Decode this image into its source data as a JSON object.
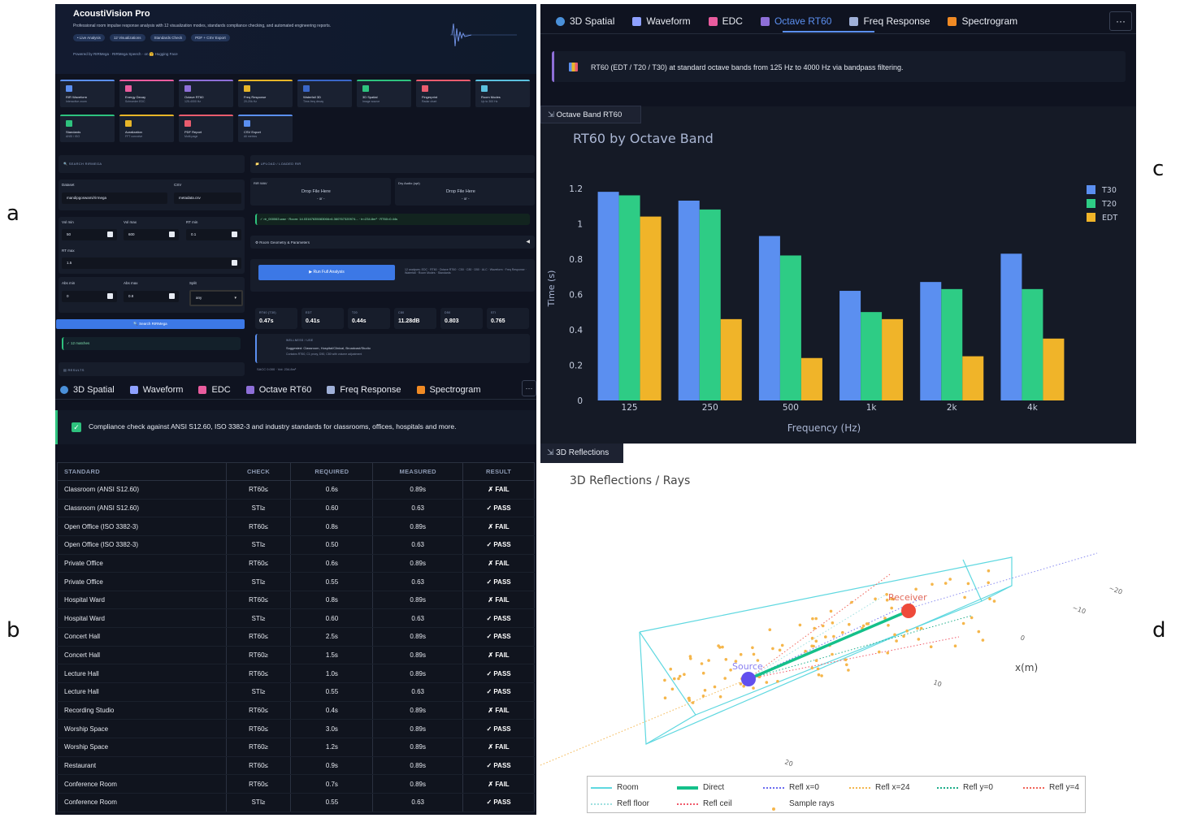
{
  "panel_labels": {
    "a": "a",
    "b": "b",
    "c": "c",
    "d": "d"
  },
  "app": {
    "title": "AcoustiVision Pro",
    "subtitle": "Professional room impulse response analysis with 12 visualization modes, standards compliance checking, and automated engineering reports.",
    "pills": [
      "• Live Analysis",
      "12 Visualizations",
      "Standards Check",
      "PDF + CSV Export"
    ],
    "credit": "Powered by  RIRMega  ·  RIRMega Speech  ·  on 🤗 Hugging Face"
  },
  "cards": [
    {
      "title": "RIR Waveform",
      "sub": "Interactive zoom",
      "color": "#5b8ff0"
    },
    {
      "title": "Energy Decay",
      "sub": "Schroeder EDC",
      "color": "#e95c9e"
    },
    {
      "title": "Octave RT60",
      "sub": "125-4000 Hz",
      "color": "#8e6fd8"
    },
    {
      "title": "Freq Response",
      "sub": "20-20k Hz",
      "color": "#e7b528"
    },
    {
      "title": "Waterfall 3D",
      "sub": "Time-freq decay",
      "color": "#3a66c8"
    },
    {
      "title": "3D Spatial",
      "sub": "Image source",
      "color": "#2ec27e"
    },
    {
      "title": "Fingerprint",
      "sub": "Radar chart",
      "color": "#e95c6e"
    },
    {
      "title": "Room Modes",
      "sub": "Up to 300 Hz",
      "color": "#5bc0de"
    },
    {
      "title": "Standards",
      "sub": "ANSI / ISO",
      "color": "#2ec27e"
    },
    {
      "title": "Auralization",
      "sub": "FFT convolve",
      "color": "#e7b528"
    },
    {
      "title": "PDF Report",
      "sub": "Multi-page",
      "color": "#e95c6e"
    },
    {
      "title": "CSV Export",
      "sub": "All metrics",
      "color": "#5b8ff0"
    }
  ],
  "search": {
    "header": "🔍 SEARCH RIRMEGA",
    "dataset_label": "Dataset",
    "dataset_value": "mandipgoswami/rirmega",
    "csv_label": "CSV",
    "csv_value": "metadata.csv",
    "vol_min_label": "Vol min",
    "vol_min": "50",
    "vol_max_label": "Vol max",
    "vol_max": "600",
    "rt_min_label": "RT min",
    "rt_min": "0.1",
    "rt_max_label": "RT max",
    "rt_max": "1.5",
    "abs_min_label": "Abs min",
    "abs_min": "0",
    "abs_max_label": "Abs max",
    "abs_max": "0.8",
    "split_label": "Split",
    "split_value": "any",
    "button": "🔍 Search RIRMega",
    "matches": "✓ 12 matches",
    "results_header": "▤ RESULTS"
  },
  "upload": {
    "header": "📁 UPLOAD / LOADED RIR",
    "rir_label": "RIR WAV",
    "dry_label": "Dry Audio (opt)",
    "drop_text": "Drop File Here",
    "or_text": "- or -",
    "loaded": "✓ rir_000063.wav · Room: 14.03167635083066×6.360767320974... · tr=234.8m³ · RT60=0.44s",
    "geometry": "⚙ Room Geometry & Parameters",
    "run_button": "▶ Run Full Analysis",
    "run_note": "12 analyses: EDC · RT60 · Octave RT60 · C50 · C80 · D50 · ALC · Waveform · Freq Response · Waterfall · Room Modes · Standards",
    "metrics": [
      {
        "label": "RT60 (T30)",
        "value": "0.47s"
      },
      {
        "label": "EDT",
        "value": "0.41s"
      },
      {
        "label": "T20",
        "value": "0.44s"
      },
      {
        "label": "C80",
        "value": "11.28dB"
      },
      {
        "label": "D50",
        "value": "0.803"
      },
      {
        "label": "STI",
        "value": "0.765"
      }
    ],
    "wellness_header": "WELLNESS / USE",
    "wellness_text": "Suggested: Classroom, Hospital/Clinical, Broadcast/Studio",
    "wellness_sub": "Contains RT60, C1 proxy, D50, C80 with volume adjustment",
    "footer": "SACC 0.000 · Vol: 234.8m³"
  },
  "tabs_bottom": [
    {
      "label": "3D Spatial",
      "icon": "globe-icon",
      "color": "#4a90d9"
    },
    {
      "label": "Waveform",
      "icon": "wave-icon",
      "color": "#8ea0ff"
    },
    {
      "label": "EDC",
      "icon": "chart-down-icon",
      "color": "#e95c9e"
    },
    {
      "label": "Octave RT60",
      "icon": "bar-chart-icon",
      "color": "#8e6fd8"
    },
    {
      "label": "Freq Response",
      "icon": "line-chart-icon",
      "color": "#9fb0d8"
    },
    {
      "label": "Spectrogram",
      "icon": "flame-icon",
      "color": "#f08a24"
    }
  ],
  "tabs_top": [
    {
      "label": "3D Spatial",
      "icon": "globe-icon",
      "color": "#4a90d9"
    },
    {
      "label": "Waveform",
      "icon": "wave-icon",
      "color": "#8ea0ff"
    },
    {
      "label": "EDC",
      "icon": "chart-down-icon",
      "color": "#e95c9e"
    },
    {
      "label": "Octave RT60",
      "icon": "bar-chart-icon",
      "color": "#8e6fd8"
    },
    {
      "label": "Freq Response",
      "icon": "line-chart-icon",
      "color": "#9fb0d8"
    },
    {
      "label": "Spectrogram",
      "icon": "flame-icon",
      "color": "#f08a24"
    }
  ],
  "more_label": "···",
  "compliance": {
    "note": "Compliance check against ANSI S12.60, ISO 3382-3 and industry standards for classrooms, offices, hospitals and more.",
    "columns": [
      "STANDARD",
      "CHECK",
      "REQUIRED",
      "MEASURED",
      "RESULT"
    ],
    "rows": [
      [
        "Classroom (ANSI S12.60)",
        "RT60≤",
        "0.6s",
        "0.89s",
        "✗ FAIL"
      ],
      [
        "Classroom (ANSI S12.60)",
        "STI≥",
        "0.60",
        "0.63",
        "✓ PASS"
      ],
      [
        "Open Office (ISO 3382-3)",
        "RT60≤",
        "0.8s",
        "0.89s",
        "✗ FAIL"
      ],
      [
        "Open Office (ISO 3382-3)",
        "STI≥",
        "0.50",
        "0.63",
        "✓ PASS"
      ],
      [
        "Private Office",
        "RT60≤",
        "0.6s",
        "0.89s",
        "✗ FAIL"
      ],
      [
        "Private Office",
        "STI≥",
        "0.55",
        "0.63",
        "✓ PASS"
      ],
      [
        "Hospital Ward",
        "RT60≤",
        "0.8s",
        "0.89s",
        "✗ FAIL"
      ],
      [
        "Hospital Ward",
        "STI≥",
        "0.60",
        "0.63",
        "✓ PASS"
      ],
      [
        "Concert Hall",
        "RT60≤",
        "2.5s",
        "0.89s",
        "✓ PASS"
      ],
      [
        "Concert Hall",
        "RT60≥",
        "1.5s",
        "0.89s",
        "✗ FAIL"
      ],
      [
        "Lecture Hall",
        "RT60≤",
        "1.0s",
        "0.89s",
        "✓ PASS"
      ],
      [
        "Lecture Hall",
        "STI≥",
        "0.55",
        "0.63",
        "✓ PASS"
      ],
      [
        "Recording Studio",
        "RT60≤",
        "0.4s",
        "0.89s",
        "✗ FAIL"
      ],
      [
        "Worship Space",
        "RT60≤",
        "3.0s",
        "0.89s",
        "✓ PASS"
      ],
      [
        "Worship Space",
        "RT60≥",
        "1.2s",
        "0.89s",
        "✗ FAIL"
      ],
      [
        "Restaurant",
        "RT60≤",
        "0.9s",
        "0.89s",
        "✓ PASS"
      ],
      [
        "Conference Room",
        "RT60≤",
        "0.7s",
        "0.89s",
        "✗ FAIL"
      ],
      [
        "Conference Room",
        "STI≥",
        "0.55",
        "0.63",
        "✓ PASS"
      ]
    ]
  },
  "octave": {
    "note": "RT60 (EDT / T20 / T30) at standard octave bands from 125 Hz to 4000 Hz via bandpass filtering.",
    "section_label": "Octave Band RT60"
  },
  "chart_data": {
    "type": "bar",
    "title": "RT60 by Octave Band",
    "xlabel": "Frequency (Hz)",
    "ylabel": "Time (s)",
    "categories": [
      "125",
      "250",
      "500",
      "1k",
      "2k",
      "4k"
    ],
    "ylim": [
      0,
      1.3
    ],
    "yticks": [
      "0",
      "0.2",
      "0.4",
      "0.6",
      "0.8",
      "1",
      "1.2"
    ],
    "series": [
      {
        "name": "T30",
        "values": [
          1.18,
          1.13,
          0.93,
          0.62,
          0.67,
          0.83
        ],
        "color": "#5b8ff0"
      },
      {
        "name": "T20",
        "values": [
          1.16,
          1.08,
          0.82,
          0.5,
          0.63,
          0.63
        ],
        "color": "#2ecc85"
      },
      {
        "name": "EDT",
        "values": [
          1.04,
          0.46,
          0.24,
          0.46,
          0.25,
          0.35
        ],
        "color": "#f0b429"
      }
    ],
    "legend": "right",
    "grid": false
  },
  "spatial": {
    "section_label": "3D Reflections",
    "title": "3D Reflections / Rays",
    "source_label": "Source",
    "receiver_label": "Receiver",
    "axis_x": "x(m)",
    "ticks": [
      "~20",
      "~10",
      "0",
      "10",
      "20"
    ],
    "legend": [
      {
        "label": "Room",
        "color": "#5fd8e0",
        "style": "solid"
      },
      {
        "label": "Direct",
        "color": "#14c08a",
        "style": "thick"
      },
      {
        "label": "Refl x=0",
        "color": "#6b6cf0",
        "style": "dotted"
      },
      {
        "label": "Refl x=24",
        "color": "#f3b64f",
        "style": "dotted"
      },
      {
        "label": "Refl y=0",
        "color": "#1fae8a",
        "style": "dotted"
      },
      {
        "label": "Refl y=4",
        "color": "#f0655a",
        "style": "dotted"
      },
      {
        "label": "Refl floor",
        "color": "#9ee0e0",
        "style": "dotted"
      },
      {
        "label": "Refl ceil",
        "color": "#f05a6a",
        "style": "dotted"
      },
      {
        "label": "Sample rays",
        "color": "#f5b64b",
        "style": "dot"
      }
    ]
  }
}
